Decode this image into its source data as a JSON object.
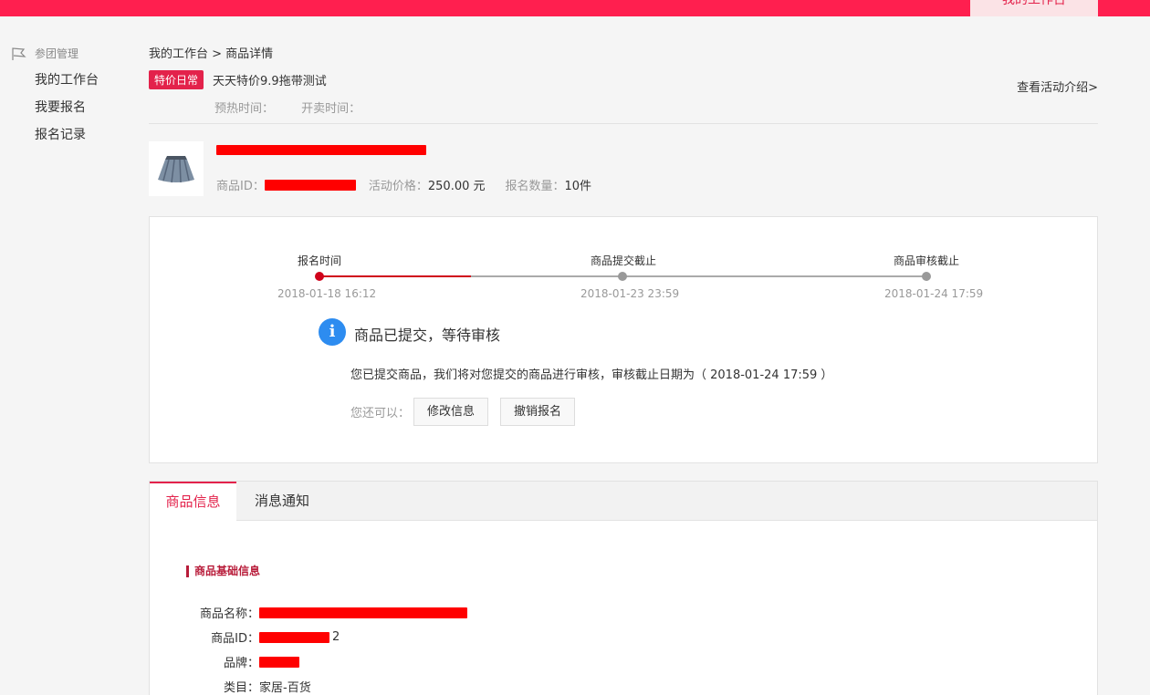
{
  "header": {
    "workspace_tab": "我的工作台"
  },
  "sidebar": {
    "section_title": "参团管理",
    "items": [
      {
        "label": "我的工作台"
      },
      {
        "label": "我要报名"
      },
      {
        "label": "报名记录"
      }
    ]
  },
  "breadcrumb": "我的工作台 > 商品详情",
  "activity": {
    "badge": "特价日常",
    "name": "天天特价9.9拖带测试",
    "preheat_label": "预热时间：",
    "sale_label": "开卖时间：",
    "intro_link": "查看活动介绍>"
  },
  "product": {
    "id_label": "商品ID：",
    "price_label": "活动价格：",
    "price_value": "250.00 元",
    "quantity_label": "报名数量：",
    "quantity_value": "10件"
  },
  "timeline": {
    "progress": 0.5,
    "steps": [
      {
        "label": "报名时间",
        "date": "2018-01-18 16:12",
        "done": true
      },
      {
        "label": "商品提交截止",
        "date": "2018-01-23 23:59",
        "done": false
      },
      {
        "label": "商品审核截止",
        "date": "2018-01-24 17:59",
        "done": false
      }
    ]
  },
  "status": {
    "icon": "info-icon",
    "title": "商品已提交，等待审核",
    "description": "您已提交商品，我们将对您提交的商品进行审核，审核截止日期为（ 2018-01-24 17:59 ）",
    "actions_label": "您还可以：",
    "edit_button": "修改信息",
    "cancel_button": "撤销报名"
  },
  "tabs": [
    {
      "label": "商品信息",
      "active": true
    },
    {
      "label": "消息通知",
      "active": false
    }
  ],
  "basic_info": {
    "section_title": "商品基础信息",
    "name_label": "商品名称：",
    "id_label": "商品ID：",
    "id_suffix": "2",
    "brand_label": "品牌：",
    "category_label": "类目：",
    "category_value": "家居-百货"
  },
  "colors": {
    "brand": "#ff1f4f",
    "accent": "#e3224b",
    "progress": "#d0021b",
    "info": "#2d8cf0"
  }
}
